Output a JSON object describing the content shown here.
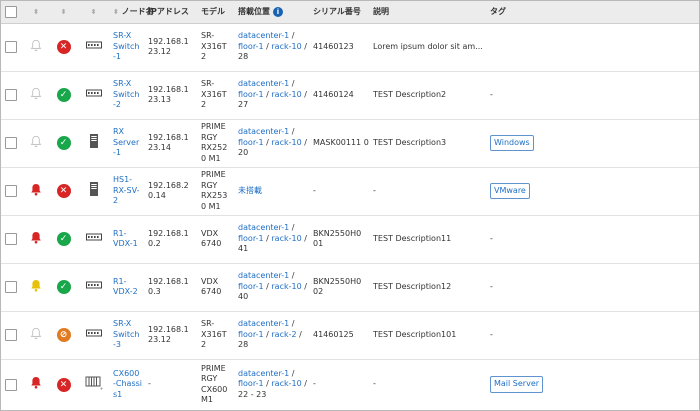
{
  "header": {
    "node_name": "ノード名",
    "ip_address": "IPアドレス",
    "model": "モデル",
    "location": "搭載位置",
    "serial": "シリアル番号",
    "description": "説明",
    "tags": "タグ"
  },
  "colors": {
    "bell_alert": "#d82626",
    "bell_warning": "#e6c20a",
    "bell_normal": "#bfbfbf",
    "status_error": "#d82626",
    "status_ok": "#1aa64a",
    "status_warn": "#e07b22"
  },
  "rows": [
    {
      "name": "SR-X Switch -1",
      "ip": "192.168.1 23.12",
      "model": "SR-X316T 2",
      "loc_dc": "datacenter-1",
      "loc_floor": "floor-1",
      "loc_rack": "rack-10",
      "loc_pos": "28",
      "serial": "41460123",
      "desc": "Lorem ipsum dolor sit am...",
      "tag": "",
      "bell": "normal",
      "status": "error",
      "type": "switch-icon"
    },
    {
      "name": "SR-X Switch -2",
      "ip": "192.168.1 23.13",
      "model": "SR-X316T 2",
      "loc_dc": "datacenter-1",
      "loc_floor": "floor-1",
      "loc_rack": "rack-10",
      "loc_pos": "27",
      "serial": "41460124",
      "desc": "TEST Description2",
      "tag": "-",
      "bell": "normal",
      "status": "ok",
      "type": "switch-icon"
    },
    {
      "name": "RX Server -1",
      "ip": "192.168.1 23.14",
      "model": "PRIME RGY RX252 0 M1",
      "loc_dc": "datacenter-1",
      "loc_floor": "floor-1",
      "loc_rack": "rack-10",
      "loc_pos": "20",
      "serial": "MASK00111 0",
      "desc": "TEST Description3",
      "tag": "Windows",
      "bell": "normal",
      "status": "ok",
      "type": "server-icon"
    },
    {
      "name": "HS1-RX-SV-2",
      "ip": "192.168.2 0.14",
      "model": "PRIME RGY RX253 0 M1",
      "loc_unmounted": "未搭載",
      "serial": "-",
      "desc": "-",
      "tag": "VMware",
      "bell": "alert",
      "status": "error",
      "type": "server-icon"
    },
    {
      "name": "R1-VDX-1",
      "ip": "192.168.1 0.2",
      "model": "VDX 6740",
      "loc_dc": "datacenter-1",
      "loc_floor": "floor-1",
      "loc_rack": "rack-10",
      "loc_pos": "41",
      "serial": "BKN2550H0 01",
      "desc": "TEST Description11",
      "tag": "-",
      "bell": "alert",
      "status": "ok",
      "type": "switch-icon"
    },
    {
      "name": "R1-VDX-2",
      "ip": "192.168.1 0.3",
      "model": "VDX 6740",
      "loc_dc": "datacenter-1",
      "loc_floor": "floor-1",
      "loc_rack": "rack-10",
      "loc_pos": "40",
      "serial": "BKN2550H0 02",
      "desc": "TEST Description12",
      "tag": "-",
      "bell": "warning",
      "status": "ok",
      "type": "switch-icon"
    },
    {
      "name": "SR-X Switch -3",
      "ip": "192.168.1 23.12",
      "model": "SR-X316T 2",
      "loc_dc": "datacenter-1",
      "loc_floor": "floor-1",
      "loc_rack": "rack-2",
      "loc_pos": "28",
      "serial": "41460125",
      "desc": "TEST Description101",
      "tag": "-",
      "bell": "normal",
      "status": "warn",
      "type": "switch-icon"
    },
    {
      "name": "CX600 -Chassi s1",
      "ip": "-",
      "model": "PRIME RGY CX600 M1",
      "loc_dc": "datacenter-1",
      "loc_floor": "floor-1",
      "loc_rack": "rack-10",
      "loc_pos": "22 - 23",
      "serial": "-",
      "desc": "-",
      "tag": "Mail Server",
      "bell": "alert",
      "status": "error",
      "type": "chassis-icon"
    }
  ]
}
